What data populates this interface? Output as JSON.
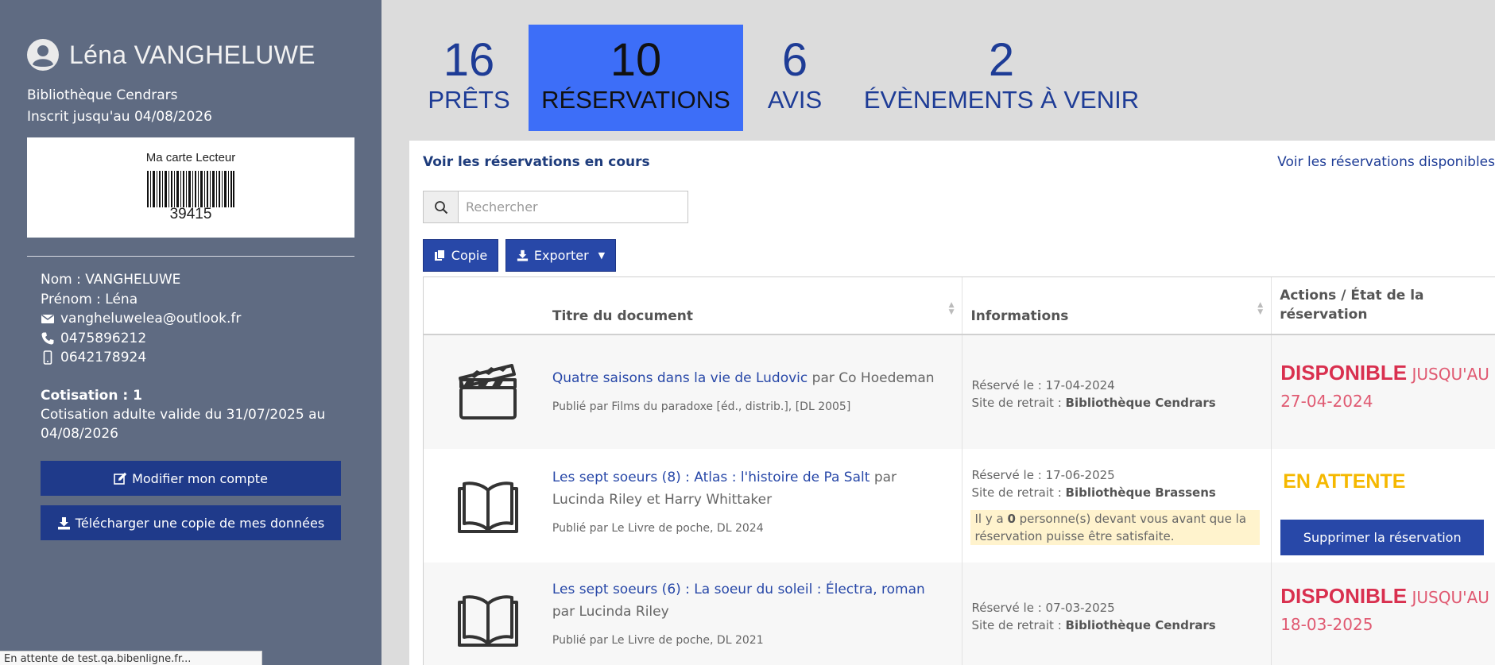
{
  "user": {
    "name": "Léna VANGHELUWE",
    "library": "Bibliothèque Cendrars",
    "inscription": "Inscrit jusqu'au 04/08/2026",
    "card_title": "Ma carte Lecteur",
    "card_number": "39415",
    "nom": "Nom : VANGHELUWE",
    "prenom": "Prénom : Léna",
    "email": "vangheluwelea@outlook.fr",
    "phone": "0475896212",
    "mobile": "0642178924",
    "cotisation_label": "Cotisation : 1",
    "cotisation_text": "Cotisation adulte valide du 31/07/2025 au 04/08/2026",
    "btn_modifier": "Modifier mon compte",
    "btn_telecharger": "Télécharger une copie de mes données"
  },
  "status_bar": "En attente de test.qa.bibenligne.fr...",
  "tabs": [
    {
      "num": "16",
      "label": "PRÊTS"
    },
    {
      "num": "10",
      "label": "RÉSERVATIONS"
    },
    {
      "num": "6",
      "label": "AVIS"
    },
    {
      "num": "2",
      "label": "ÉVÈNEMENTS À VENIR"
    }
  ],
  "panel": {
    "link_encours": "Voir les réservations en cours",
    "link_dispo": "Voir les réservations disponibles",
    "search_placeholder": "Rechercher",
    "btn_copie": "Copie",
    "btn_export": "Exporter"
  },
  "table": {
    "headers": {
      "titre": "Titre du document",
      "info": "Informations",
      "actions": "Actions / État de la réservation"
    },
    "rows": [
      {
        "icon": "film-clapper-icon",
        "title": "Quatre saisons dans la vie de Ludovic",
        "by": " par Co Hoedeman",
        "pub": "Publié par Films du paradoxe [éd., distrib.], [DL 2005]",
        "reserve_label": "Réservé le : ",
        "reserve_date": "17-04-2024",
        "site_label": "Site de retrait : ",
        "site": "Bibliothèque Cendrars",
        "status_big": "DISPONIBLE",
        "status_small": " JUSQU'AU",
        "status_date": "27-04-2024"
      },
      {
        "icon": "open-book-icon",
        "title": "Les sept soeurs (8) : Atlas : l'histoire de Pa Salt",
        "by": " par Lucinda Riley et Harry Whittaker",
        "pub": "Publié par Le Livre de poche, DL 2024",
        "reserve_label": "Réservé le : ",
        "reserve_date": "17-06-2025",
        "site_label": "Site de retrait : ",
        "site": "Bibliothèque Brassens",
        "note_a": "Il y a ",
        "note_b": "0",
        "note_c": " personne(s) devant vous avant que la réservation puisse être satisfaite.",
        "status": "EN ATTENTE",
        "btn_suppr": "Supprimer la réservation"
      },
      {
        "icon": "open-book-icon",
        "title": "Les sept soeurs (6) : La soeur du soleil : Électra, roman",
        "by": " par Lucinda Riley",
        "pub": "Publié par Le Livre de poche, DL 2021",
        "reserve_label": "Réservé le : ",
        "reserve_date": "07-03-2025",
        "site_label": "Site de retrait : ",
        "site": "Bibliothèque Cendrars",
        "status_big": "DISPONIBLE",
        "status_small": " JUSQU'AU",
        "status_date": "18-03-2025"
      }
    ]
  },
  "colors": {
    "sidebar": "#5f6b82",
    "primary": "#2848a8",
    "active_tab": "#3d6ef8",
    "available": "#d9304f",
    "waiting": "#f5b800"
  }
}
